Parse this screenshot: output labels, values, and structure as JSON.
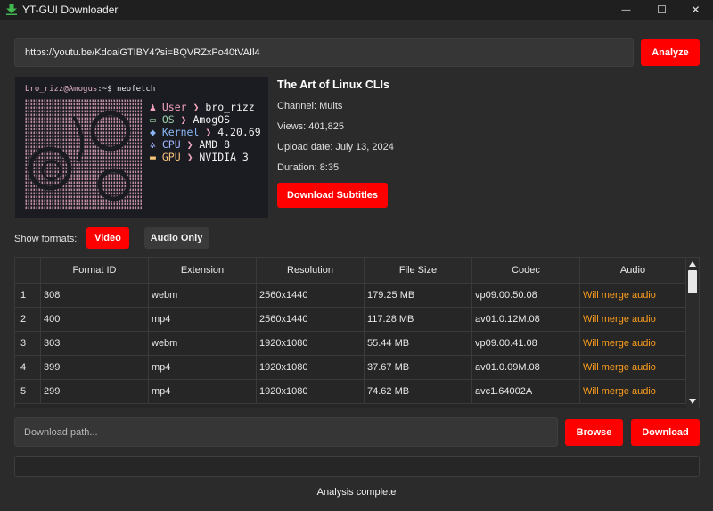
{
  "window": {
    "title": "YT-GUI Downloader",
    "icon": "download-arrow-icon",
    "minimize_glyph": "—",
    "maximize_glyph": "☐",
    "close_glyph": "✕"
  },
  "url_bar": {
    "value": "https://youtu.be/KdoaiGTIBY4?si=BQVRZxPo40tVAIl4",
    "analyze_label": "Analyze"
  },
  "thumbnail": {
    "prompt_user": "bro_rizz@Amogus",
    "prompt_rest": ":~$ neofetch",
    "rows": [
      {
        "label": "User",
        "value": "bro_rizz"
      },
      {
        "label": "OS",
        "value": "AmogOS"
      },
      {
        "label": "Kernel",
        "value": "4.20.69"
      },
      {
        "label": "CPU",
        "value": "AMD 8"
      },
      {
        "label": "GPU",
        "value": "NVIDIA 3"
      }
    ]
  },
  "video": {
    "title": "The Art of Linux CLIs",
    "channel": "Channel: Mults",
    "views": "Views: 401,825",
    "upload_date": "Upload date: July 13, 2024",
    "duration": "Duration: 8:35",
    "download_subtitles_label": "Download Subtitles"
  },
  "formats": {
    "label": "Show formats:",
    "video_label": "Video",
    "audio_only_label": "Audio Only",
    "selected": "Video"
  },
  "table": {
    "columns": [
      "Format ID",
      "Extension",
      "Resolution",
      "File Size",
      "Codec",
      "Audio"
    ],
    "rows": [
      {
        "num": "1",
        "format_id": "308",
        "extension": "webm",
        "resolution": "2560x1440",
        "file_size": "179.25 MB",
        "codec": "vp09.00.50.08",
        "audio": "Will merge audio"
      },
      {
        "num": "2",
        "format_id": "400",
        "extension": "mp4",
        "resolution": "2560x1440",
        "file_size": "117.28 MB",
        "codec": "av01.0.12M.08",
        "audio": "Will merge audio"
      },
      {
        "num": "3",
        "format_id": "303",
        "extension": "webm",
        "resolution": "1920x1080",
        "file_size": "55.44 MB",
        "codec": "vp09.00.41.08",
        "audio": "Will merge audio"
      },
      {
        "num": "4",
        "format_id": "399",
        "extension": "mp4",
        "resolution": "1920x1080",
        "file_size": "37.67 MB",
        "codec": "av01.0.09M.08",
        "audio": "Will merge audio"
      },
      {
        "num": "5",
        "format_id": "299",
        "extension": "mp4",
        "resolution": "1920x1080",
        "file_size": "74.62 MB",
        "codec": "avc1.64002A",
        "audio": "Will merge audio"
      }
    ]
  },
  "download": {
    "path_placeholder": "Download path...",
    "path_value": "",
    "browse_label": "Browse",
    "download_label": "Download",
    "progress": 0
  },
  "status": "Analysis complete",
  "colors": {
    "accent": "#ff0000",
    "audio_text": "#ff9f1c",
    "background": "#2b2b2b"
  }
}
